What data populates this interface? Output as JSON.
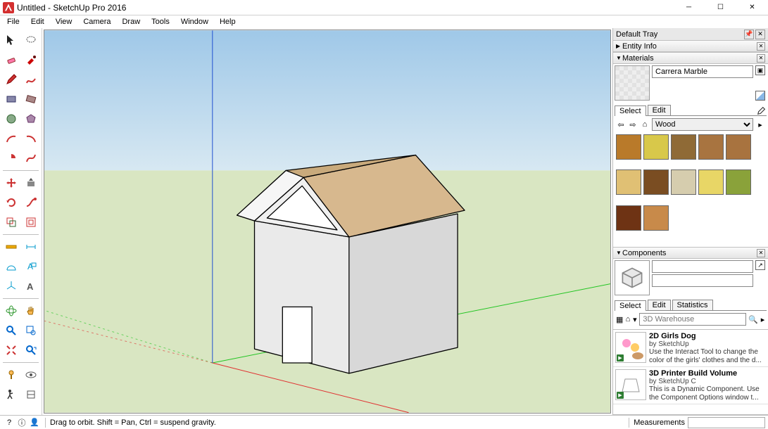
{
  "title": "Untitled - SketchUp Pro 2016",
  "menu": [
    "File",
    "Edit",
    "View",
    "Camera",
    "Draw",
    "Tools",
    "Window",
    "Help"
  ],
  "tray": {
    "title": "Default Tray"
  },
  "panels": {
    "entity_info": {
      "title": "Entity Info",
      "expanded": false
    },
    "materials": {
      "title": "Materials",
      "current_name": "Carrera Marble",
      "tabs": [
        "Select",
        "Edit"
      ],
      "active_tab": "Select",
      "library": "Wood",
      "swatches": [
        "#b97a2a",
        "#d8c84a",
        "#8f6a36",
        "#a87440",
        "#a8733f",
        "#e0c074",
        "#7a4d22",
        "#d6cdae",
        "#e8d666",
        "#8aa23a",
        "#6e3314",
        "#c88a4a"
      ]
    },
    "components": {
      "title": "Components",
      "tabs": [
        "Select",
        "Edit",
        "Statistics"
      ],
      "active_tab": "Select",
      "search_placeholder": "3D Warehouse",
      "items": [
        {
          "name": "2D Girls Dog",
          "author": "by SketchUp",
          "desc": "Use the Interact Tool to change the color of the girls' clothes and the d..."
        },
        {
          "name": "3D Printer Build Volume",
          "author": "by SketchUp C",
          "desc": "This is a Dynamic Component. Use the Component Options window t..."
        }
      ]
    }
  },
  "status": {
    "hint": "Drag to orbit. Shift = Pan, Ctrl = suspend gravity.",
    "measurements_label": "Measurements"
  },
  "tools": [
    [
      "select",
      "lasso"
    ],
    [
      "eraser",
      "paint"
    ],
    [
      "pencil",
      "freehand"
    ],
    [
      "rectangle",
      "rot-rect"
    ],
    [
      "circle",
      "polygon"
    ],
    [
      "arc",
      "arc2"
    ],
    [
      "pie",
      "bezier"
    ],
    [],
    [
      "move",
      "pushpull"
    ],
    [
      "rotate",
      "followme"
    ],
    [
      "scale",
      "offset"
    ],
    [],
    [
      "tape",
      "dimension"
    ],
    [
      "protractor",
      "text"
    ],
    [
      "axes",
      "3dtext"
    ],
    [],
    [
      "orbit",
      "pan"
    ],
    [
      "zoom",
      "zoomwin"
    ],
    [
      "zoomext",
      "prev"
    ],
    [],
    [
      "position",
      "look"
    ],
    [
      "walk",
      "section"
    ]
  ]
}
